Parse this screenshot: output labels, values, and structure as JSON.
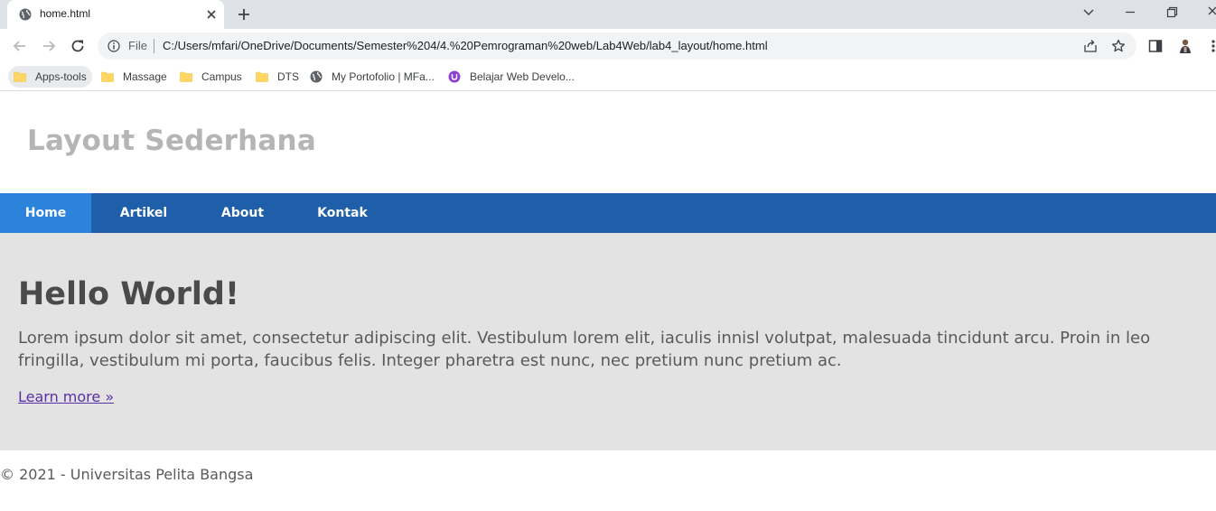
{
  "browser": {
    "tab_title": "home.html",
    "omnibox": {
      "scheme_label": "File",
      "url": "C:/Users/mfari/OneDrive/Documents/Semester%204/4.%20Pemrograman%20web/Lab4Web/lab4_layout/home.html"
    },
    "bookmarks": [
      {
        "label": "Apps-tools",
        "icon": "folder-icon"
      },
      {
        "label": "Massage",
        "icon": "folder-icon"
      },
      {
        "label": "Campus",
        "icon": "folder-icon"
      },
      {
        "label": "DTS",
        "icon": "folder-icon"
      },
      {
        "label": "My Portofolio | MFa...",
        "icon": "globe-icon"
      },
      {
        "label": "Belajar Web Develo...",
        "icon": "site-logo-icon"
      }
    ],
    "colors": {
      "tabstrip": "#dee1e6",
      "omnibox": "#f1f3f4",
      "folder": "#fdd663"
    }
  },
  "page": {
    "header_title": "Layout Sederhana",
    "nav": [
      {
        "label": "Home",
        "active": true
      },
      {
        "label": "Artikel",
        "active": false
      },
      {
        "label": "About",
        "active": false
      },
      {
        "label": "Kontak",
        "active": false
      }
    ],
    "hero": {
      "heading": "Hello World!",
      "text": "Lorem ipsum dolor sit amet, consectetur adipiscing elit. Vestibulum lorem elit, iaculis innisl volutpat, malesuada tincidunt arcu. Proin in leo fringilla, vestibulum mi porta, faucibus felis. Integer pharetra est nunc, nec pretium nunc pretium ac.",
      "link": "Learn more »"
    },
    "footer": "© 2021 - Universitas Pelita Bangsa",
    "colors": {
      "nav_bg": "#1f5faa",
      "nav_active": "#2b83dc",
      "hero_bg": "#e3e3e3",
      "title": "#b5b5b5"
    }
  }
}
